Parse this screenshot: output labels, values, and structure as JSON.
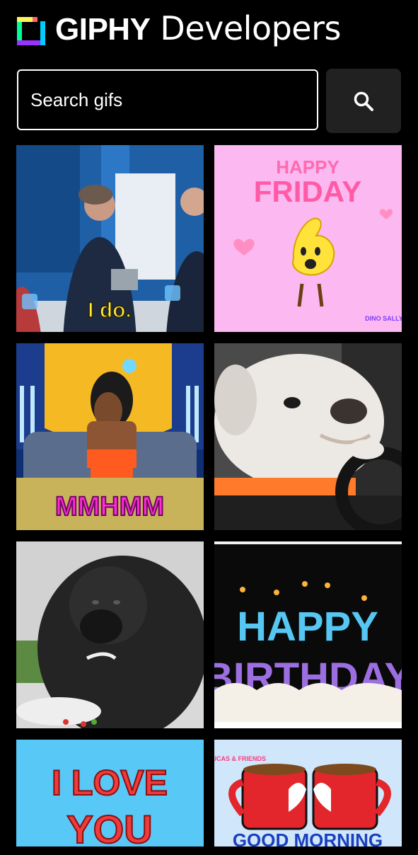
{
  "header": {
    "brand_bold": "GIPHY",
    "brand_light": "Developers",
    "logo_icon": "giphy-logo-icon"
  },
  "search": {
    "placeholder": "Search gifs",
    "button_icon": "search-icon"
  },
  "gifs": [
    {
      "caption": "I do."
    },
    {
      "line1": "HAPPY",
      "line2": "FRIDAY",
      "brand": "DINO SALLY"
    },
    {
      "caption": "MMHMM"
    },
    {},
    {},
    {
      "line1": "HAPPY",
      "line2": "BIRTHDAY"
    },
    {
      "line1": "I LOVE",
      "line2": "YOU"
    },
    {
      "brand": "LUCAS & FRIENDS",
      "caption": "GOOD MORNING"
    }
  ],
  "colors": {
    "background": "#000000",
    "search_button": "#212121",
    "text": "#ffffff"
  }
}
